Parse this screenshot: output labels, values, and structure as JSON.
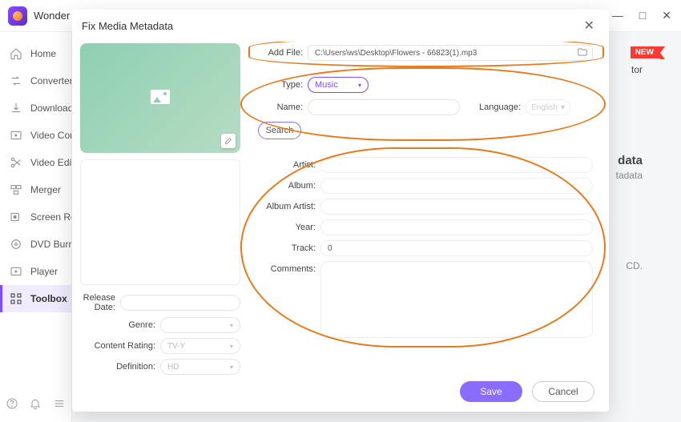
{
  "titlebar": {
    "brand": "Wonder"
  },
  "sidebar": {
    "items": [
      {
        "label": "Home"
      },
      {
        "label": "Converter"
      },
      {
        "label": "Download"
      },
      {
        "label": "Video Compressor"
      },
      {
        "label": "Video Editor"
      },
      {
        "label": "Merger"
      },
      {
        "label": "Screen Recorder"
      },
      {
        "label": "DVD Burner"
      },
      {
        "label": "Player"
      },
      {
        "label": "Toolbox"
      }
    ]
  },
  "bg": {
    "badge": "NEW",
    "tor": "tor",
    "data": "data",
    "tadata": "tadata",
    "cd": "CD."
  },
  "modal": {
    "title": "Fix Media Metadata",
    "add_file_label": "Add File:",
    "file_path": "C:\\Users\\ws\\Desktop\\Flowers - 66823(1).mp3",
    "type_label": "Type:",
    "type_value": "Music",
    "name_label": "Name:",
    "language_label": "Language:",
    "language_value": "English",
    "search_label": "Search",
    "fields": {
      "artist": "Artist:",
      "album": "Album:",
      "album_artist": "Album Artist:",
      "year": "Year:",
      "track": "Track:",
      "track_value": "0",
      "comments": "Comments:"
    },
    "meta": {
      "release_date": "Release Date:",
      "genre": "Genre:",
      "content_rating": "Content Rating:",
      "content_rating_value": "TV-Y",
      "definition": "Definition:",
      "definition_value": "HD"
    },
    "save": "Save",
    "cancel": "Cancel"
  }
}
